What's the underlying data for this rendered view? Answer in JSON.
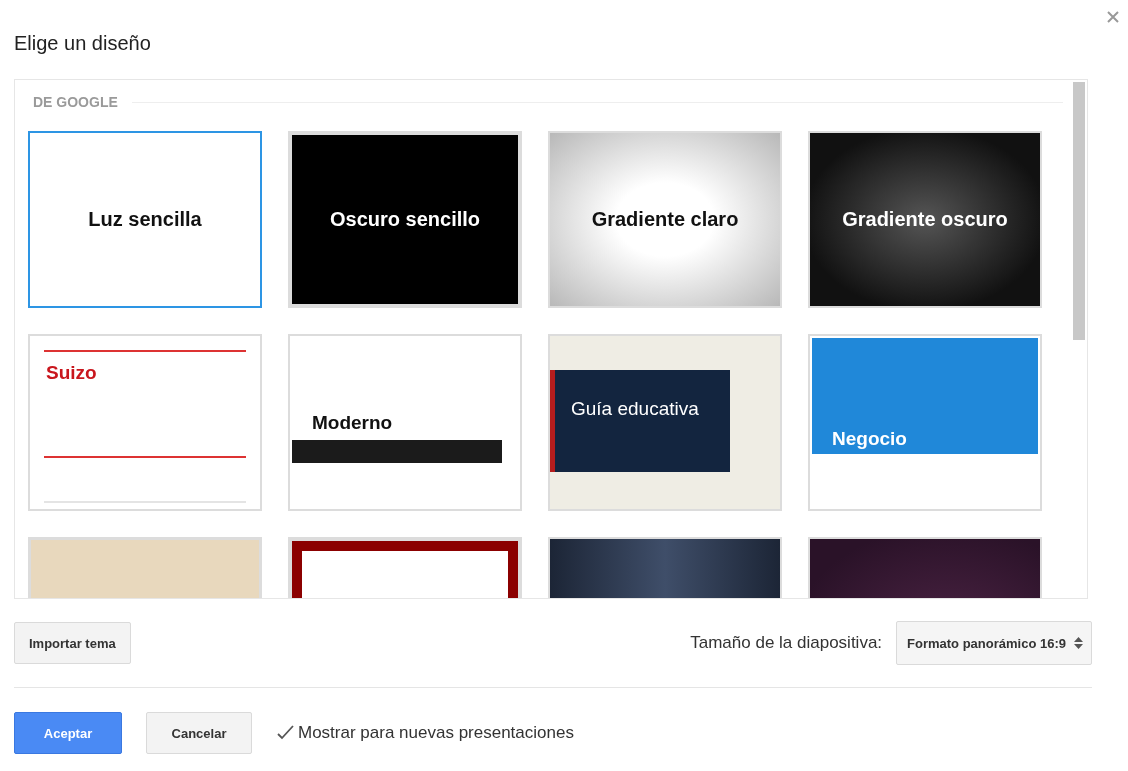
{
  "dialog": {
    "title": "Elige un diseño"
  },
  "gallery": {
    "section": "DE GOOGLE",
    "themes": [
      {
        "kind": "light",
        "title": "Luz sencilla",
        "selected": true
      },
      {
        "kind": "dark",
        "title": "Oscuro sencillo",
        "selected": false
      },
      {
        "kind": "gradient-light",
        "title": "Gradiente claro",
        "selected": false
      },
      {
        "kind": "gradient-dark",
        "title": "Gradiente oscuro",
        "selected": false
      },
      {
        "kind": "swiss",
        "title": "Suizo",
        "selected": false
      },
      {
        "kind": "modern",
        "title": "Moderno",
        "selected": false
      },
      {
        "kind": "guide",
        "title": "Guía educativa",
        "selected": false
      },
      {
        "kind": "business",
        "title": "Negocio",
        "selected": false
      },
      {
        "kind": "beige",
        "selected": false
      },
      {
        "kind": "frame",
        "selected": false
      },
      {
        "kind": "navy",
        "selected": false
      },
      {
        "kind": "plum",
        "selected": false
      }
    ]
  },
  "import_button": "Importar tema",
  "slide_size": {
    "label": "Tamaño de la diapositiva:",
    "value": "Formato panorámico 16:9"
  },
  "buttons": [
    {
      "kind": "primary",
      "label": "Aceptar"
    },
    {
      "kind": "secondary",
      "label": "Cancelar"
    }
  ],
  "show_for_new": {
    "label": "Mostrar para nuevas presentaciones",
    "checked": true
  }
}
